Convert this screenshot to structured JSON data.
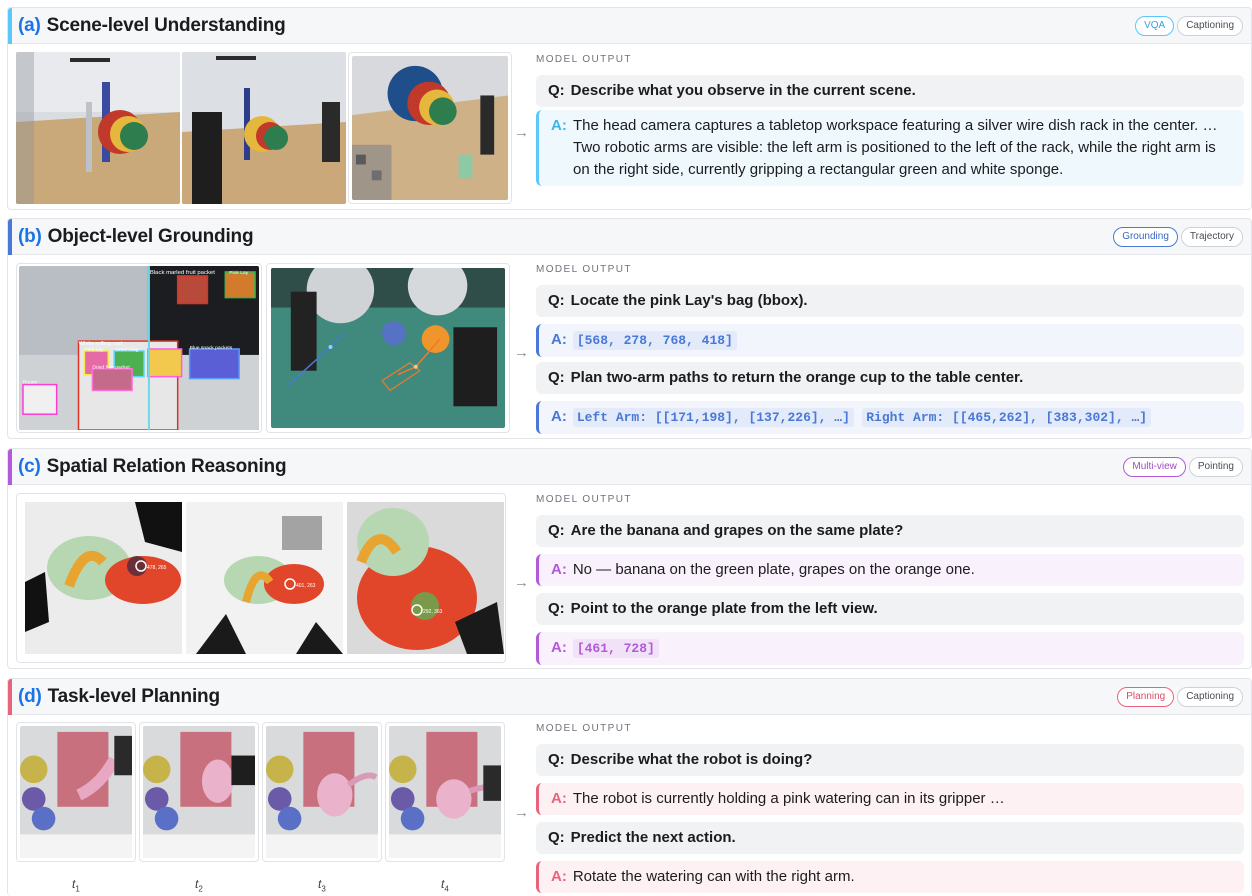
{
  "panels": {
    "a": {
      "letter": "(a)",
      "title": "Scene-level Understanding",
      "accent": "#5ac8fa",
      "tags": [
        "VQA",
        "Captioning"
      ],
      "output_label": "MODEL OUTPUT",
      "q_label": "Q:",
      "a_label": "A:",
      "question": "Describe what you observe in the current scene.",
      "answer": "The head camera captures a tabletop workspace featuring a silver wire dish rack in the center. … Two robotic arms are visible: the left arm is positioned to the left of the rack, while the right arm is on the right side, currently gripping a rectangular green and white sponge."
    },
    "b": {
      "letter": "(b)",
      "title": "Object-level Grounding",
      "accent": "#4a78d6",
      "tags": [
        "Grounding",
        "Trajectory"
      ],
      "output_label": "MODEL OUTPUT",
      "q_label": "Q:",
      "a_label": "A:",
      "q1": "Locate the pink Lay's bag (bbox).",
      "a1": "[568, 278, 768, 418]",
      "q2": "Plan two-arm paths to return the orange cup to the table center.",
      "a2_left": "Left Arm: [[171,198], [137,226], …]",
      "a2_right": "Right Arm: [[465,262], [383,302], …]",
      "box_labels": [
        "Black marled fruit packet",
        "Pink Lay",
        "White rolling cart",
        "Pink Lay",
        "Green bag",
        "Blue snack packets",
        "Dried fruit packet",
        "Router"
      ]
    },
    "c": {
      "letter": "(c)",
      "title": "Spatial Relation Reasoning",
      "accent": "#b25ad9",
      "tags": [
        "Multi-view",
        "Pointing"
      ],
      "output_label": "MODEL OUTPUT",
      "q_label": "Q:",
      "a_label": "A:",
      "q1": "Are the banana and grapes on the same plate?",
      "a1": "No — banana on the green plate, grapes on the orange one.",
      "q2": "Point to the orange plate from the left view.",
      "a2": "[461, 728]",
      "point_labels": [
        "478, 265",
        "401, 263",
        "292, 363"
      ]
    },
    "d": {
      "letter": "(d)",
      "title": "Task-level Planning",
      "accent": "#e8647c",
      "tags": [
        "Planning",
        "Captioning"
      ],
      "output_label": "MODEL OUTPUT",
      "q_label": "Q:",
      "a_label": "A:",
      "q1": "Describe what the robot is doing?",
      "a1": "The robot is currently holding a pink watering can in its gripper …",
      "q2": "Predict the next action.",
      "a2": "Rotate the watering can with the right arm.",
      "time_labels": [
        "t",
        "t",
        "t",
        "t"
      ],
      "time_subs": [
        "1",
        "2",
        "3",
        "4"
      ]
    }
  },
  "arrow_glyph": "→"
}
